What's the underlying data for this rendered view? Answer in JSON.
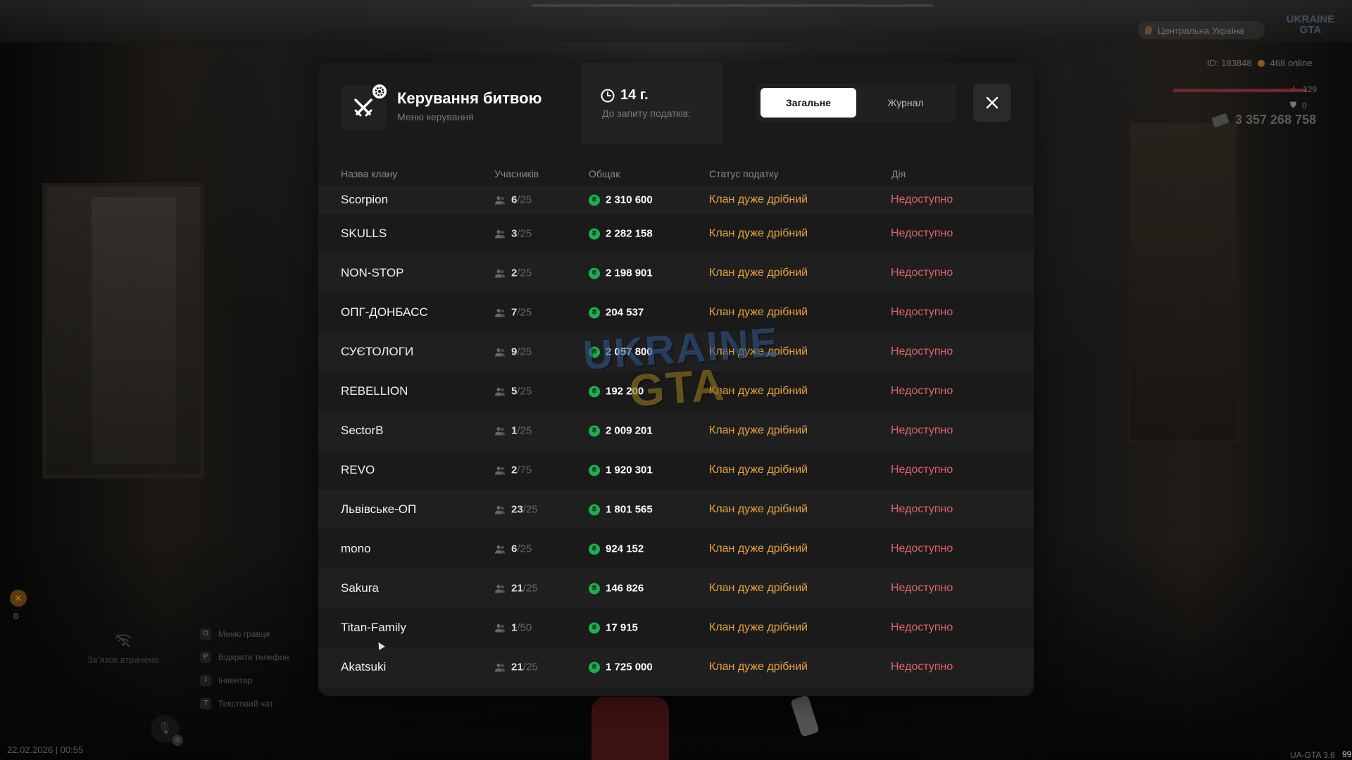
{
  "hud": {
    "region": "Центральна Україна",
    "logo": "UKRAINE GTA",
    "id_text": "ID: 183848",
    "online": "468 online",
    "health": "129",
    "armor": "0",
    "money": "3 357 268 758",
    "coins": "0",
    "signal_lost": "Зв'язок втрачено",
    "keys": [
      {
        "key": "O",
        "label": "Меню гравця"
      },
      {
        "key": "P",
        "label": "Відкрити телефон"
      },
      {
        "key": "I",
        "label": "Інвентар"
      },
      {
        "key": "T",
        "label": "Текстовий чат"
      }
    ],
    "mic_badge": "R",
    "datetime": "22.02.2026 | 00:55",
    "version": "UA-GTA 3.6",
    "fps": "99",
    "icons": {
      "mic": "microphone-icon",
      "signal": "wifi-off-icon",
      "health": "cross-icon",
      "armor": "shield-icon",
      "money": "cash-icon"
    }
  },
  "modal": {
    "title": "Керування битвою",
    "subtitle": "Меню керування",
    "tax": {
      "value": "14 г.",
      "label": "До запиту податків:"
    },
    "tabs": [
      {
        "label": "Загальне",
        "active": true
      },
      {
        "label": "Журнал",
        "active": false
      }
    ],
    "columns": [
      "Назва клану",
      "Учасників",
      "Общак",
      "Статус податку",
      "Дія"
    ],
    "watermark": {
      "line1": "UKRAINE",
      "line2": "GTA"
    },
    "clans": [
      {
        "name": "Scorpion",
        "members": "6",
        "max": "/25",
        "fund": "2 310 600",
        "status": "Клан дуже дрібний",
        "action": "Недоступно"
      },
      {
        "name": "SKULLS",
        "members": "3",
        "max": "/25",
        "fund": "2 282 158",
        "status": "Клан дуже дрібний",
        "action": "Недоступно"
      },
      {
        "name": "NON-STOP",
        "members": "2",
        "max": "/25",
        "fund": "2 198 901",
        "status": "Клан дуже дрібний",
        "action": "Недоступно"
      },
      {
        "name": "ОПГ-ДОНБАСС",
        "members": "7",
        "max": "/25",
        "fund": "204 537",
        "status": "Клан дуже дрібний",
        "action": "Недоступно"
      },
      {
        "name": "СУЄТОЛОГИ",
        "members": "9",
        "max": "/25",
        "fund": "2 057 800",
        "status": "Клан дуже дрібний",
        "action": "Недоступно"
      },
      {
        "name": "REBELLION",
        "members": "5",
        "max": "/25",
        "fund": "192 200",
        "status": "Клан дуже дрібний",
        "action": "Недоступно"
      },
      {
        "name": "SectorB",
        "members": "1",
        "max": "/25",
        "fund": "2 009 201",
        "status": "Клан дуже дрібний",
        "action": "Недоступно"
      },
      {
        "name": "REVO",
        "members": "2",
        "max": "/75",
        "fund": "1 920 301",
        "status": "Клан дуже дрібний",
        "action": "Недоступно"
      },
      {
        "name": "Львівське-ОП",
        "members": "23",
        "max": "/25",
        "fund": "1 801 565",
        "status": "Клан дуже дрібний",
        "action": "Недоступно"
      },
      {
        "name": "mono",
        "members": "6",
        "max": "/25",
        "fund": "924 152",
        "status": "Клан дуже дрібний",
        "action": "Недоступно"
      },
      {
        "name": "Sakura",
        "members": "21",
        "max": "/25",
        "fund": "146 826",
        "status": "Клан дуже дрібний",
        "action": "Недоступно"
      },
      {
        "name": "Titan-Family",
        "members": "1",
        "max": "/50",
        "fund": "17 915",
        "status": "Клан дуже дрібний",
        "action": "Недоступно"
      },
      {
        "name": "Akatsuki",
        "members": "21",
        "max": "/25",
        "fund": "1 725 000",
        "status": "Клан дуже дрібний",
        "action": "Недоступно"
      }
    ]
  },
  "colors": {
    "status_warning": "#e8a23b",
    "action_unavailable": "#e0626a",
    "coin": "#1fae4f",
    "modal_bg": "#1a1a1b"
  }
}
